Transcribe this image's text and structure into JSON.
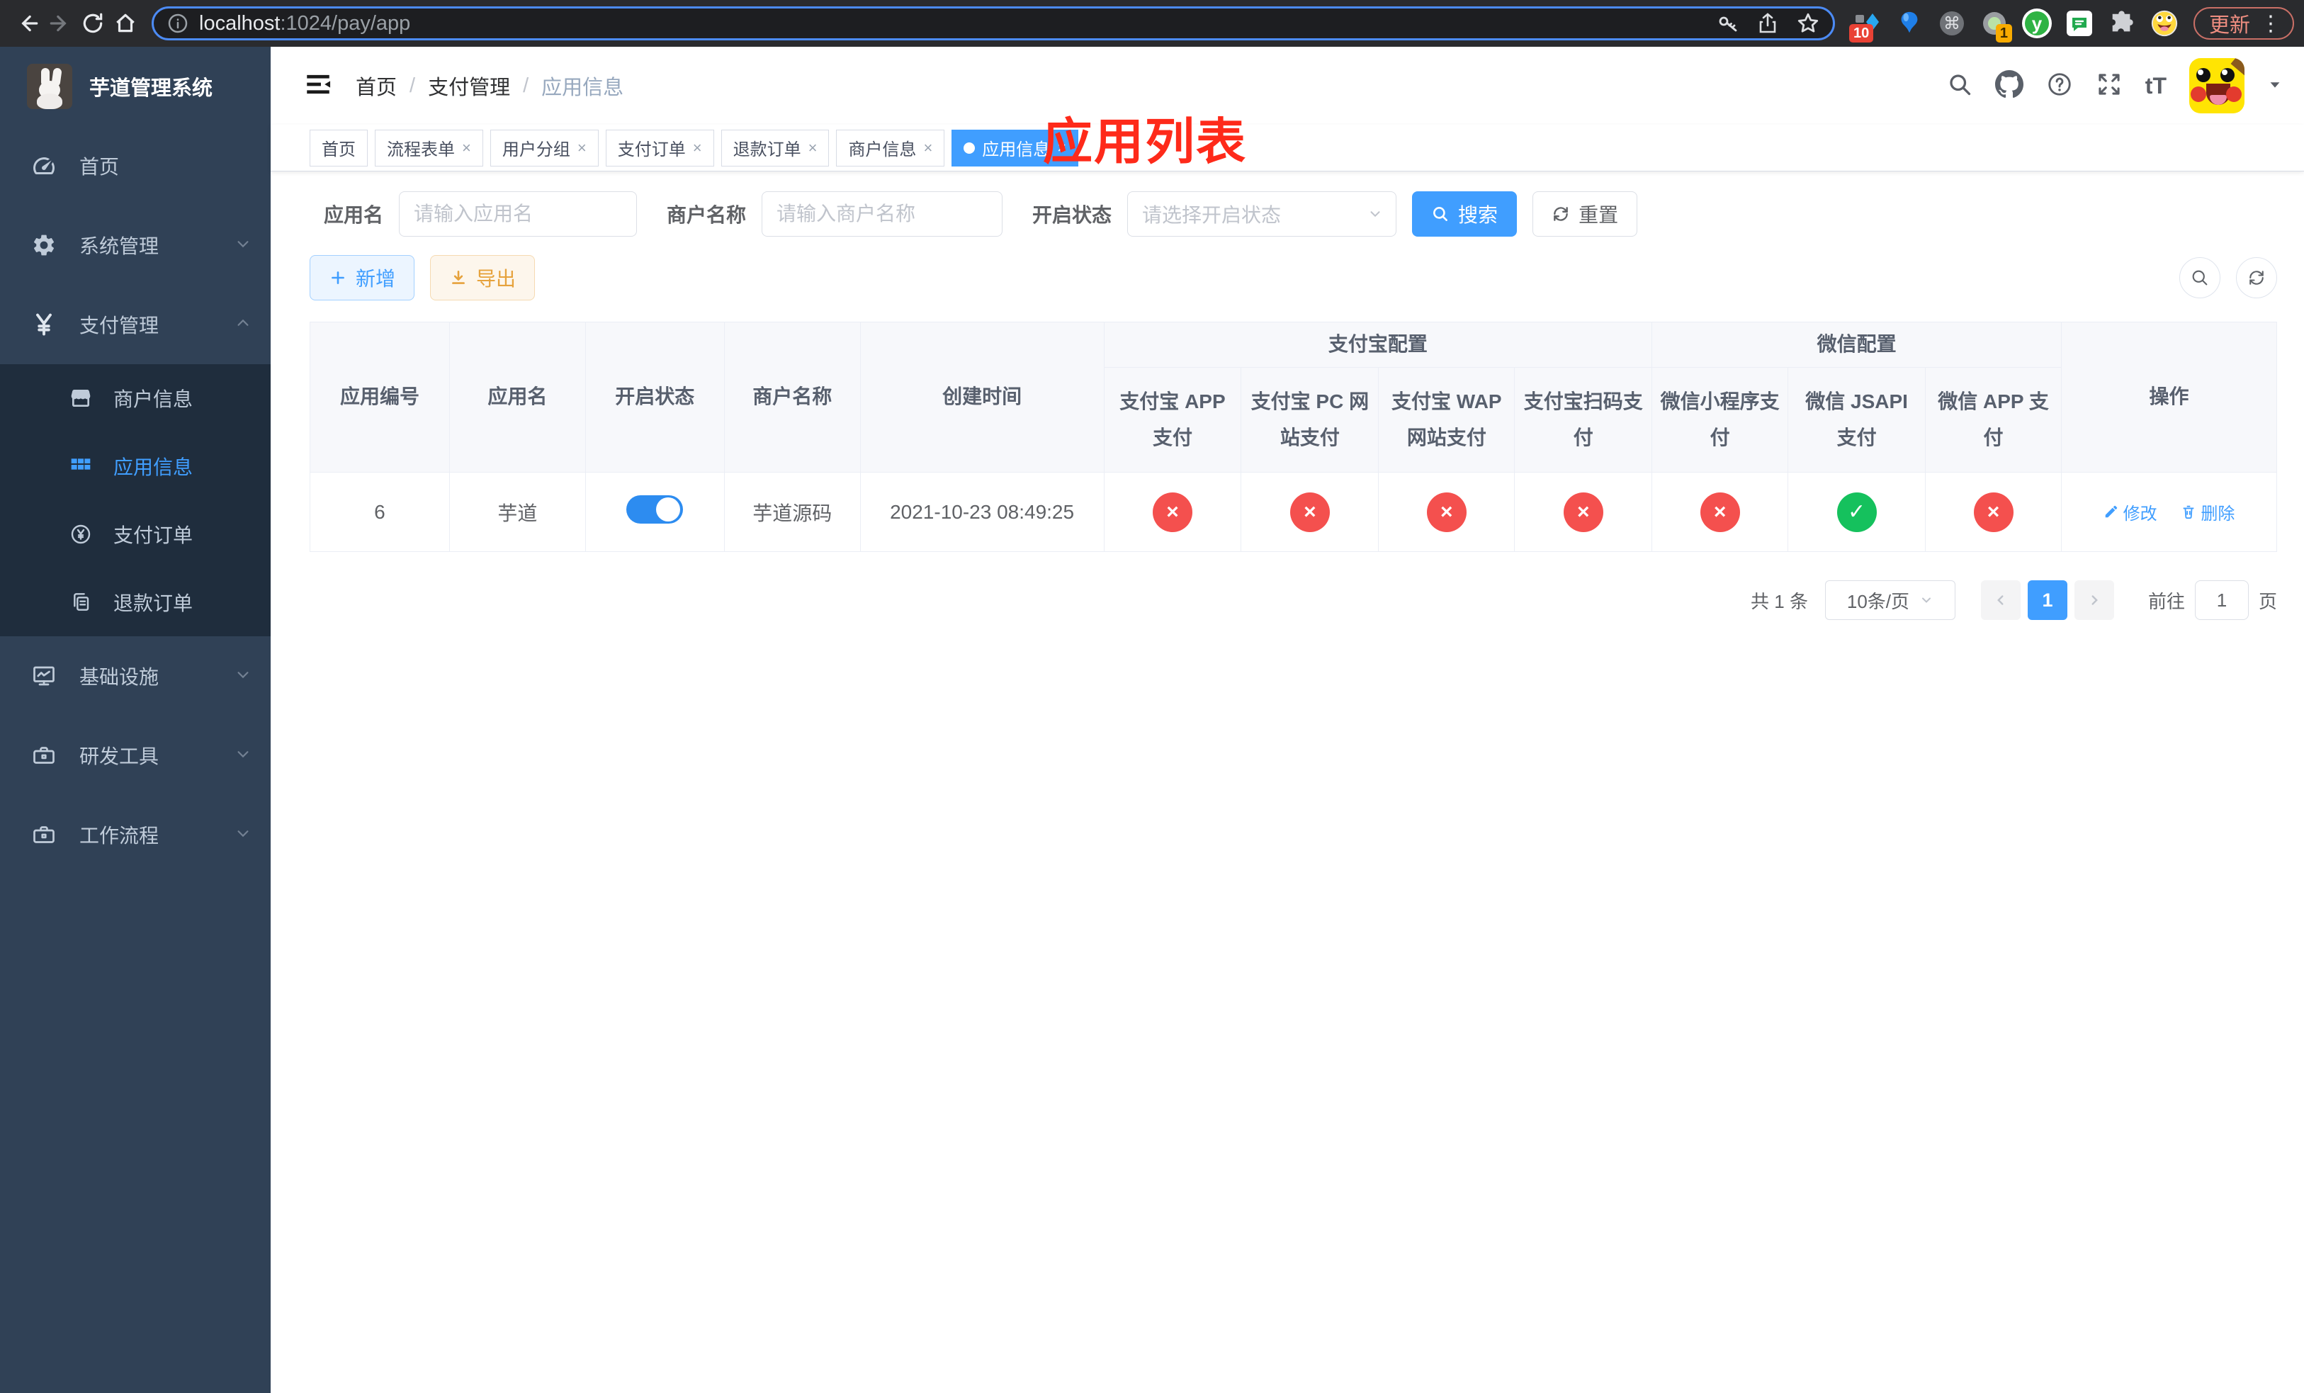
{
  "colors": {
    "primary": "#409eff",
    "success": "#15c15d",
    "danger": "#f4504e",
    "warning": "#e6a23c",
    "sidebar": "#304156"
  },
  "icons": {
    "close": "×",
    "cmd": "⌘",
    "dots": "⋮",
    "plus": "+",
    "caret": "▾",
    "font_size": "tT",
    "question": "?",
    "yen": "¥",
    "star": "☆"
  },
  "browser": {
    "url": {
      "host": "localhost",
      "path": ":1024/pay/app"
    },
    "update_label": "更新",
    "badges": [
      "10",
      "1"
    ],
    "ext_y_letter": "y"
  },
  "sidebar": {
    "title": "芋道管理系统",
    "items": [
      {
        "label": "首页"
      },
      {
        "label": "系统管理"
      },
      {
        "label": "支付管理"
      }
    ],
    "subitems": [
      {
        "label": "商户信息"
      },
      {
        "label": "应用信息"
      },
      {
        "label": "支付订单"
      },
      {
        "label": "退款订单"
      }
    ],
    "items2": [
      {
        "label": "基础设施"
      },
      {
        "label": "研发工具"
      },
      {
        "label": "工作流程"
      }
    ]
  },
  "header": {
    "breadcrumb": [
      "首页",
      "支付管理",
      "应用信息"
    ],
    "annotation": "应用列表"
  },
  "tabs": [
    {
      "label": "首页"
    },
    {
      "label": "流程表单"
    },
    {
      "label": "用户分组"
    },
    {
      "label": "支付订单"
    },
    {
      "label": "退款订单"
    },
    {
      "label": "商户信息"
    },
    {
      "label": "应用信息"
    }
  ],
  "filters": {
    "app_name": {
      "label": "应用名",
      "placeholder": "请输入应用名"
    },
    "merchant": {
      "label": "商户名称",
      "placeholder": "请输入商户名称"
    },
    "status": {
      "label": "开启状态",
      "placeholder": "请选择开启状态"
    },
    "search_label": "搜索",
    "reset_label": "重置"
  },
  "toolbar": {
    "add_label": "新增",
    "export_label": "导出"
  },
  "table": {
    "groups": {
      "alipay": "支付宝配置",
      "wechat": "微信配置"
    },
    "columns": [
      "应用编号",
      "应用名",
      "开启状态",
      "商户名称",
      "创建时间",
      "支付宝 APP 支付",
      "支付宝 PC 网站支付",
      "支付宝 WAP 网站支付",
      "支付宝扫码支付",
      "微信小程序支付",
      "微信 JSAPI 支付",
      "微信 APP 支付",
      "操作"
    ],
    "row": {
      "id": "6",
      "name": "芋道",
      "enabled": true,
      "merchant": "芋道源码",
      "created": "2021-10-23 08:49:25",
      "statuses": [
        false,
        false,
        false,
        false,
        false,
        true,
        false
      ],
      "edit_label": "修改",
      "delete_label": "删除"
    }
  },
  "pagination": {
    "total": "共 1 条",
    "page_size": "10条/页",
    "current": "1",
    "goto_label": "前往",
    "goto_value": "1",
    "unit": "页"
  }
}
